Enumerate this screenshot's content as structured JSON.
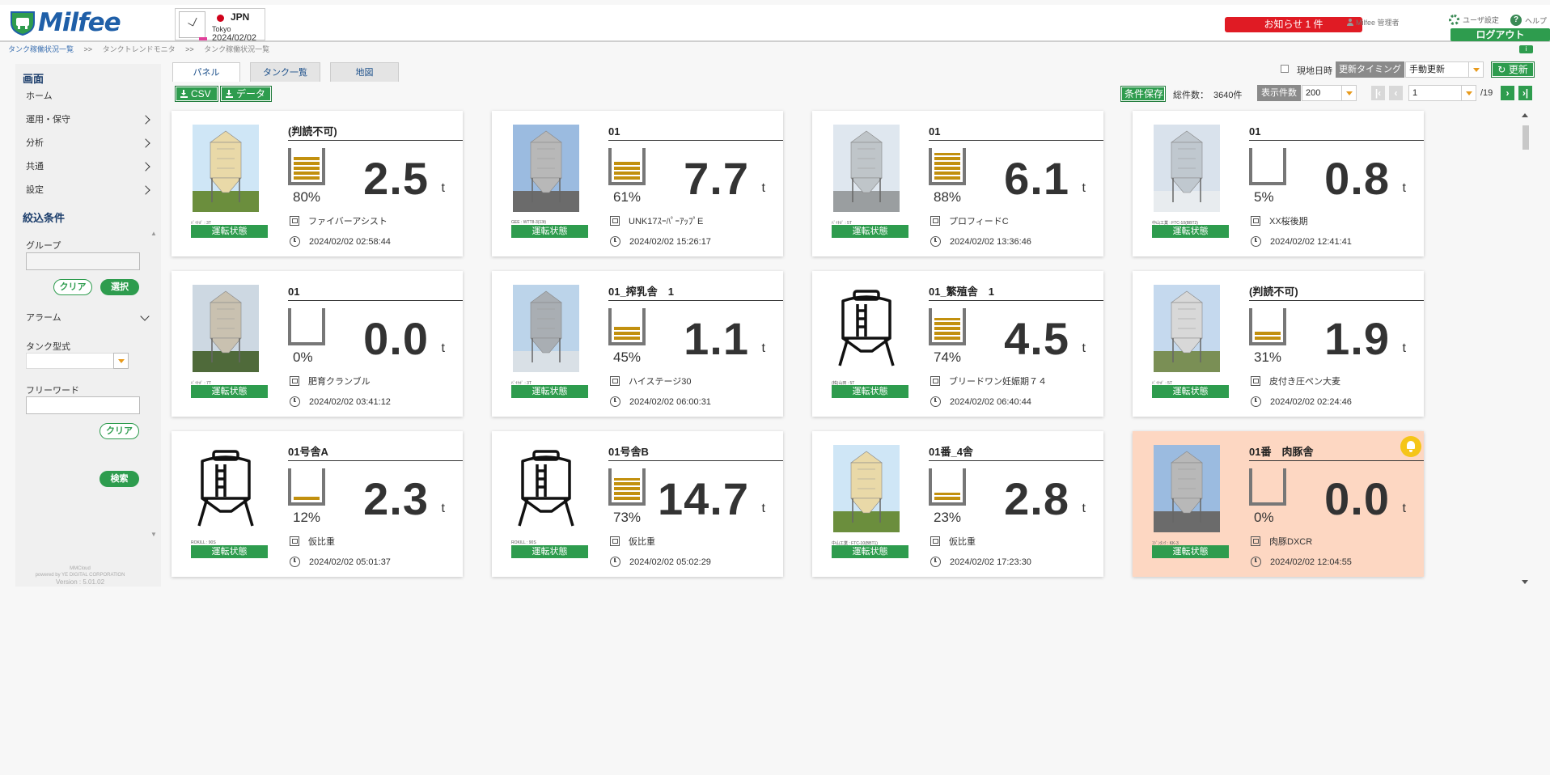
{
  "header": {
    "logo_text": "Milfee",
    "region_code": "JPN",
    "region_city": "Tokyo",
    "region_date": "2024/02/02",
    "notice_label": "お知らせ 1 件",
    "user_label": "Milfee 管理者",
    "settings_label": "ユーザ設定",
    "help_label": "ヘルプ",
    "logout_label": "ログアウト"
  },
  "breadcrumb": {
    "items": [
      "タンク稼働状況一覧",
      "タンクトレンドモニタ",
      "タンク稼働状況一覧"
    ],
    "separator": ">>"
  },
  "info_label": "i",
  "sidebar": {
    "screen_heading": "画面",
    "nav": [
      "ホーム",
      "運用・保守",
      "分析",
      "共通",
      "設定"
    ],
    "filter_heading": "絞込条件",
    "group_label": "グループ",
    "clear_label": "クリア",
    "select_label": "選択",
    "alarm_label": "アラーム",
    "tank_type_label": "タンク型式",
    "free_word_label": "フリーワード",
    "search_label": "検索",
    "footer": [
      "MMCloud",
      "powered by YE DIGITAL CORPORATION",
      "Version : 5.01.02"
    ]
  },
  "tabs": [
    "パネル",
    "タンク一覧",
    "地図"
  ],
  "toolbar": {
    "csv_label": "CSV",
    "data_label": "データ",
    "current_time_label": "現地日時",
    "timing_label": "更新タイミング",
    "timing_value": "手動更新",
    "refresh_label": "更新",
    "save_cond_label": "条件保存",
    "total_label": "総件数：",
    "total_value": "3640件",
    "display_count_label": "表示件数",
    "display_count_value": "200",
    "page_value": "1",
    "page_total": "/19"
  },
  "colors": {
    "brand_green": "#2e9c4e",
    "brand_blue": "#1f5fa8",
    "alert_bg": "#fdd7c2",
    "fill_gold": "#c2900e",
    "notice_red": "#e01b24"
  },
  "cards": [
    {
      "title": "(判読不可)",
      "caption": "ﾊﾞｲﾅｶﾞ : 3T",
      "status": "運転状態",
      "fill": 80,
      "pct": "80%",
      "value": "2.5",
      "unit": "t",
      "feed": "ファイバーアシスト",
      "time": "2024/02/02 02:58:44",
      "image": "photo",
      "alert": false
    },
    {
      "title": "01",
      "caption": "GEE : WTT8-3(13t)",
      "status": "運転状態",
      "fill": 61,
      "pct": "61%",
      "value": "7.7",
      "unit": "t",
      "feed": "UNK17ｽｰﾊﾟｰｱｯﾌﾟE",
      "time": "2024/02/02 15:26:17",
      "image": "photo",
      "alert": false
    },
    {
      "title": "01",
      "caption": "ﾊﾞｲﾅｶﾞ : 5T",
      "status": "運転状態",
      "fill": 88,
      "pct": "88%",
      "value": "6.1",
      "unit": "t",
      "feed": "プロフィードC",
      "time": "2024/02/02 13:36:46",
      "image": "photo",
      "alert": false
    },
    {
      "title": "01",
      "caption": "中山工業 : FTC-10(BBT2)",
      "status": "運転状態",
      "fill": 5,
      "pct": "5%",
      "value": "0.8",
      "unit": "t",
      "feed": "XX桜後期",
      "time": "2024/02/02 12:41:41",
      "image": "photo",
      "alert": false
    },
    {
      "title": "01",
      "caption": "ﾊﾞｲﾅｶﾞ : 7T",
      "status": "運転状態",
      "fill": 0,
      "pct": "0%",
      "value": "0.0",
      "unit": "t",
      "feed": "肥育クランブル",
      "time": "2024/02/02 03:41:12",
      "image": "photo",
      "alert": false
    },
    {
      "title": "01_搾乳舎　1",
      "caption": "ﾊﾞｲﾅｶﾞ : 3T",
      "status": "運転状態",
      "fill": 45,
      "pct": "45%",
      "value": "1.1",
      "unit": "t",
      "feed": "ハイステージ30",
      "time": "2024/02/02 06:00:31",
      "image": "photo",
      "alert": false
    },
    {
      "title": "01_繁殖舎　1",
      "caption": "(株)山田 : 5T",
      "status": "運転状態",
      "fill": 74,
      "pct": "74%",
      "value": "4.5",
      "unit": "t",
      "feed": "ブリードワン妊娠期７４",
      "time": "2024/02/02 06:40:44",
      "image": "icon",
      "alert": false
    },
    {
      "title": "(判読不可)",
      "caption": "ﾊﾞｲﾅｶﾞ : 5T",
      "status": "運転状態",
      "fill": 31,
      "pct": "31%",
      "value": "1.9",
      "unit": "t",
      "feed": "皮付き圧ペン大麦",
      "time": "2024/02/02 02:24:46",
      "image": "photo",
      "alert": false
    },
    {
      "title": "01号舎A",
      "caption": "ROKILL : 90S",
      "status": "運転状態",
      "fill": 12,
      "pct": "12%",
      "value": "2.3",
      "unit": "t",
      "feed": "仮比重",
      "time": "2024/02/02 05:01:37",
      "image": "icon",
      "alert": false
    },
    {
      "title": "01号舎B",
      "caption": "ROKILL : 90S",
      "status": "運転状態",
      "fill": 73,
      "pct": "73%",
      "value": "14.7",
      "unit": "t",
      "feed": "仮比重",
      "time": "2024/02/02 05:02:29",
      "image": "icon",
      "alert": false
    },
    {
      "title": "01番_4舎",
      "caption": "中山工業 : FTC-10(BBT1)",
      "status": "運転状態",
      "fill": 23,
      "pct": "23%",
      "value": "2.8",
      "unit": "t",
      "feed": "仮比重",
      "time": "2024/02/02 17:23:30",
      "image": "photo",
      "alert": false
    },
    {
      "title": "01番　肉豚舎",
      "caption": "ｺｼﾞﾝﾀﾝｸ : KK-3",
      "status": "運転状態",
      "fill": 0,
      "pct": "0%",
      "value": "0.0",
      "unit": "t",
      "feed": "肉豚DXCR",
      "time": "2024/02/02 12:04:55",
      "image": "photo",
      "alert": true
    }
  ]
}
